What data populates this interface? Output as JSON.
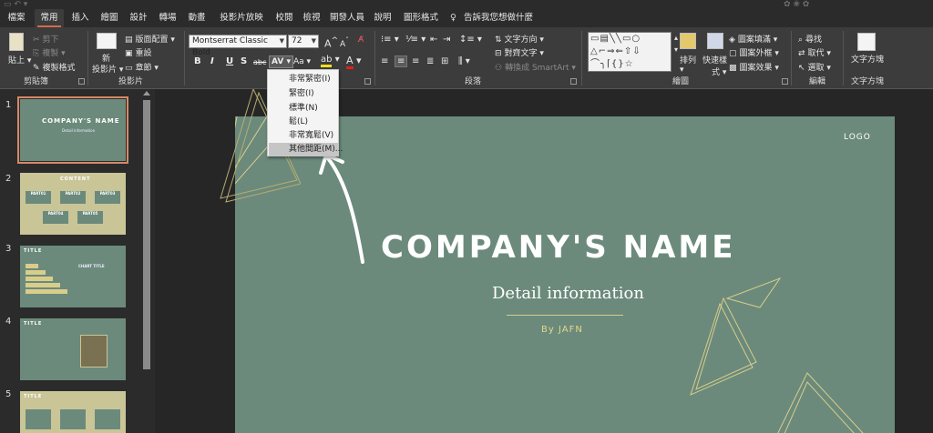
{
  "tabs": [
    "檔案",
    "常用",
    "插入",
    "繪圖",
    "設計",
    "轉場",
    "動畫",
    "投影片放映",
    "校閱",
    "檢視",
    "開發人員",
    "說明",
    "圖形格式"
  ],
  "active_tab": "常用",
  "tell_me": "告訴我您想做什麼",
  "clipboard": {
    "paste": "貼上",
    "cut": "剪下",
    "copy": "複製",
    "format_painter": "複製格式",
    "label": "剪貼簿"
  },
  "slides_group": {
    "new_slide_1": "新",
    "new_slide_2": "投影片",
    "layout": "版面配置",
    "reset": "重設",
    "section": "章節",
    "label": "投影片"
  },
  "font": {
    "name": "Montserrat Classic Bold",
    "size": "72",
    "bold": "B",
    "italic": "I",
    "underline": "U",
    "shadow": "S",
    "strike": "abc",
    "spacing": "AV",
    "case": "Aa",
    "grow": "A",
    "shrink": "A"
  },
  "paragraph": {
    "text_direction": "文字方向",
    "align_text": "對齊文字",
    "smartart": "轉換成 SmartArt",
    "label": "段落"
  },
  "drawing": {
    "arrange": "排列",
    "quick_styles_1": "快速樣",
    "quick_styles_2": "式",
    "fill": "圖案填滿",
    "outline": "圖案外框",
    "effects": "圖案效果",
    "label": "繪圖"
  },
  "editing": {
    "find": "尋找",
    "replace": "取代",
    "select": "選取",
    "label": "編輯"
  },
  "textbox": {
    "label_btn": "文字方塊",
    "label": "文字方塊"
  },
  "spacing_menu": {
    "items": [
      "非常緊密(I)",
      "緊密(I)",
      "標準(N)",
      "鬆(L)",
      "非常寬鬆(V)",
      "其他間距(M)..."
    ],
    "highlighted_index": 5
  },
  "thumbnails": [
    {
      "num": "1",
      "title": "COMPANY'S NAME",
      "sub": "Detail information"
    },
    {
      "num": "2",
      "title": "CONTENT",
      "parts": [
        "PART01",
        "PART02",
        "PART03",
        "PART04",
        "PART05"
      ]
    },
    {
      "num": "3",
      "title": "TITLE",
      "sub": "CHART TITLE"
    },
    {
      "num": "4",
      "title": "TITLE"
    },
    {
      "num": "5",
      "title": "TITLE"
    }
  ],
  "slide": {
    "logo": "LOGO",
    "company": "COMPANY'S NAME",
    "detail": "Detail information",
    "byline": "By JAFN"
  },
  "colors": {
    "slide_bg": "#6b8a7c",
    "thumb_alt_bg": "#c9c597",
    "accent_gold": "#d8cd8a",
    "tab_underline": "#d26a4f",
    "selected_outline": "#d88866"
  }
}
